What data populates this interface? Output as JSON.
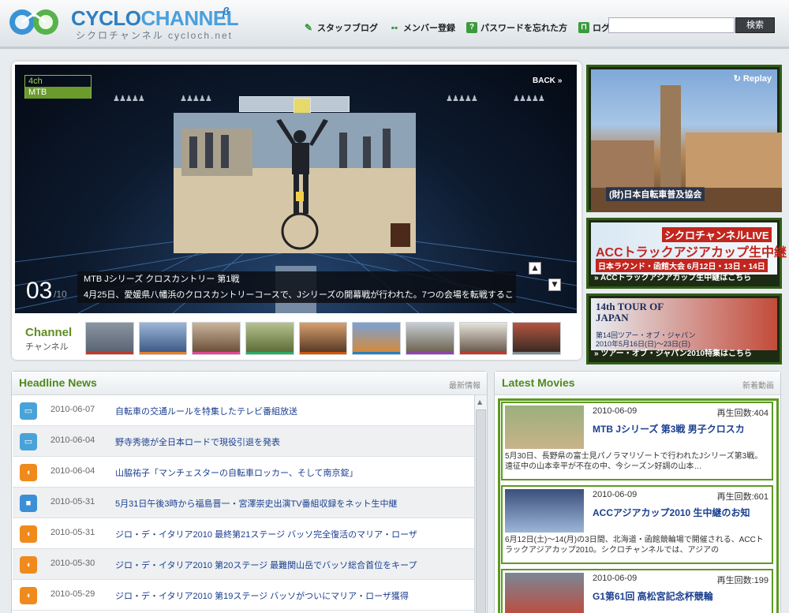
{
  "header": {
    "logo_title_a": "CYCLO",
    "logo_title_b": "CHANNEL",
    "logo_beta": "β",
    "logo_sub": "シクロチャンネル cycloch.net",
    "nav": [
      {
        "label": "スタッフブログ",
        "icon": "pencil-icon"
      },
      {
        "label": "メンバー登録",
        "icon": "members-icon"
      },
      {
        "label": "パスワードを忘れた方",
        "icon": "question-icon"
      },
      {
        "label": "ログイン",
        "icon": "lock-icon"
      }
    ],
    "search_value": "",
    "search_button": "検索"
  },
  "stage": {
    "channel_num": "4ch",
    "channel_name": "MTB",
    "back_label": "BACK",
    "back_arrows": "»",
    "slide_num": "03",
    "slide_total": "/10",
    "caption_title": "MTB Jシリーズ クロスカントリー 第1戦",
    "caption_desc": "4月25日、愛媛県八幡浜のクロスカントリーコースで、Jシリーズの開幕戦が行われた。7つの会場を転戦するこ",
    "up_arrow": "▲",
    "down_arrow": "▼"
  },
  "channel_bar": {
    "label": "Channel",
    "sub": "チャンネル",
    "thumb_colors": [
      "#c0392b",
      "#e67e22",
      "#e84393",
      "#27ae60",
      "#d35400",
      "#2980b9",
      "#8e44ad",
      "#c0392b",
      "#7f8c8d"
    ]
  },
  "side": {
    "replay": "Replay",
    "org": "(財)日本自転車普及協会",
    "acc_title": "シクロチャンネルLIVE",
    "acc_big": "ACCトラックアジアカップ生中継",
    "acc_sub": "日本ラウンド・函館大会 6月12日・13日・14日",
    "acc_caption": "ACCトラックアジアカップ生中継はこちら",
    "tour_big": "14th TOUR OF JAPAN",
    "tour_sub1": "第14回ツアー・オブ・ジャパン",
    "tour_sub2": "2010年5月16日(日)～23日(日)",
    "tour_caption": "ツアー・オブ・ジャパン2010特集はこちら",
    "caption_prefix": "»"
  },
  "news": {
    "title": "Headline News",
    "sub": "最新情報",
    "items": [
      {
        "date": "2010-06-07",
        "title": "自転車の交通ルールを特集したテレビ番組放送",
        "icon": "tv-icon",
        "color": "#4aa3d8"
      },
      {
        "date": "2010-06-04",
        "title": "野寺秀徳が全日本ロードで現役引退を発表",
        "icon": "tv-icon",
        "color": "#4aa3d8"
      },
      {
        "date": "2010-06-04",
        "title": "山脇祐子「マンチェスターの自転車ロッカー、そして南京錠」",
        "icon": "chat-icon",
        "color": "#f08a1c"
      },
      {
        "date": "2010-05-31",
        "title": "5月31日午後3時から福島晋一・宮澤崇史出演TV番組収録をネット生中継",
        "icon": "camera-icon",
        "color": "#3b8fd6"
      },
      {
        "date": "2010-05-31",
        "title": "ジロ・デ・イタリア2010 最終第21ステージ バッソ完全復活のマリア・ローザ",
        "icon": "chat-icon",
        "color": "#f08a1c"
      },
      {
        "date": "2010-05-30",
        "title": "ジロ・デ・イタリア2010 第20ステージ 最難関山岳でバッソ総合首位をキープ",
        "icon": "chat-icon",
        "color": "#f08a1c"
      },
      {
        "date": "2010-05-29",
        "title": "ジロ・デ・イタリア2010 第19ステージ バッソがついにマリア・ローザ獲得",
        "icon": "chat-icon",
        "color": "#f08a1c"
      }
    ]
  },
  "movies": {
    "title": "Latest Movies",
    "sub": "新着動画",
    "items": [
      {
        "date": "2010-06-09",
        "plays": "再生回数:404",
        "title": "MTB Jシリーズ 第3戦 男子クロスカ",
        "desc": "5月30日、長野県の富士見パノラマリゾートで行われたJシリーズ第3戦。遠征中の山本幸平が不在の中、今シーズン好調の山本…"
      },
      {
        "date": "2010-06-09",
        "plays": "再生回数:601",
        "title": "ACCアジアカップ2010 生中継のお知",
        "desc": "6月12日(土)～14(月)の3日間、北海道・函館競輪場で開催される、ACCトラックアジアカップ2010。シクロチャンネルでは、アジアの"
      },
      {
        "date": "2010-06-09",
        "plays": "再生回数:199",
        "title": "G1第61回 高松宮記念杯競輪",
        "desc": ""
      }
    ]
  }
}
